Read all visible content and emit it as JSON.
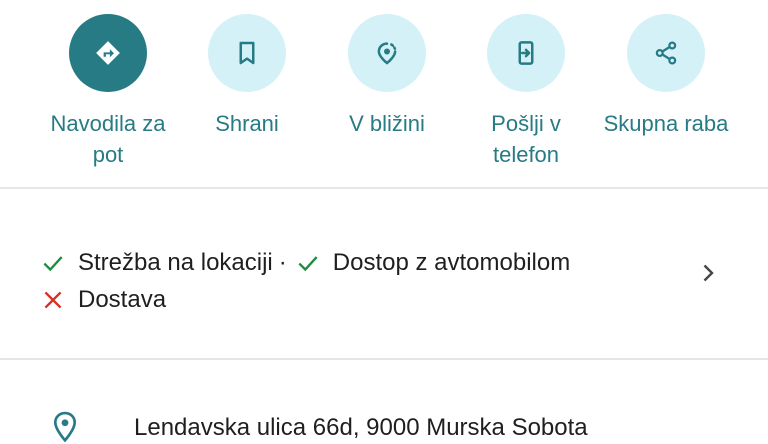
{
  "actions": [
    {
      "label": "Navodila za pot",
      "icon": "directions-icon"
    },
    {
      "label": "Shrani",
      "icon": "bookmark-icon"
    },
    {
      "label": "V bližini",
      "icon": "nearby-icon"
    },
    {
      "label": "Pošlji v telefon",
      "icon": "send-to-phone-icon"
    },
    {
      "label": "Skupna raba",
      "icon": "share-icon"
    }
  ],
  "amenities": {
    "items": [
      {
        "label": "Strežba na lokaciji",
        "available": true
      },
      {
        "label": "Dostop z avtomobilom",
        "available": true
      },
      {
        "label": "Dostava",
        "available": false
      }
    ],
    "separator": "·"
  },
  "address": {
    "text": "Lendavska ulica 66d, 9000 Murska Sobota"
  },
  "colors": {
    "accent": "#277b84",
    "action_bg": "#d4f1f8",
    "check": "#1e8e3e",
    "cross": "#d93025",
    "divider": "#e6e6e6"
  }
}
